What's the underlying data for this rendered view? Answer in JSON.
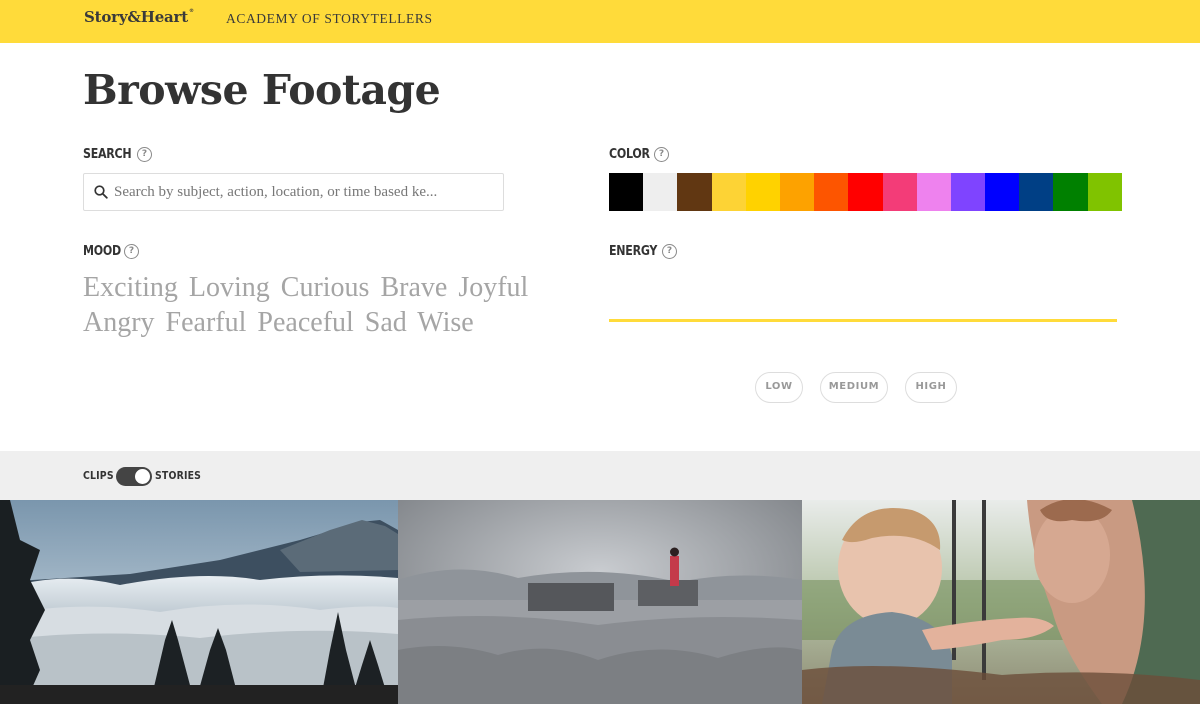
{
  "header": {
    "logo": "Story&Heart",
    "logo_mark": "®",
    "nav_link": "ACADEMY OF STORYTELLERS"
  },
  "page_title": "Browse Footage",
  "search": {
    "label": "SEARCH",
    "placeholder": "Search by subject, action, location, or time based ke..."
  },
  "color": {
    "label": "COLOR",
    "swatches": [
      "#000000",
      "#eeeeee",
      "#613712",
      "#fdd335",
      "#ffd200",
      "#fda200",
      "#fd5500",
      "#ff0000",
      "#f33c78",
      "#ee82ee",
      "#7f44ff",
      "#0000ff",
      "#003f85",
      "#008000",
      "#80c300"
    ]
  },
  "mood": {
    "label": "MOOD",
    "options": [
      "Exciting",
      "Loving",
      "Curious",
      "Brave",
      "Joyful",
      "Angry",
      "Fearful",
      "Peaceful",
      "Sad",
      "Wise"
    ]
  },
  "energy": {
    "label": "ENERGY",
    "low": "LOW",
    "medium": "MEDIUM",
    "high": "HIGH"
  },
  "view_toggle": {
    "left_label": "CLIPS",
    "right_label": "STORIES",
    "selected": "STORIES"
  },
  "help_glyph": "?"
}
